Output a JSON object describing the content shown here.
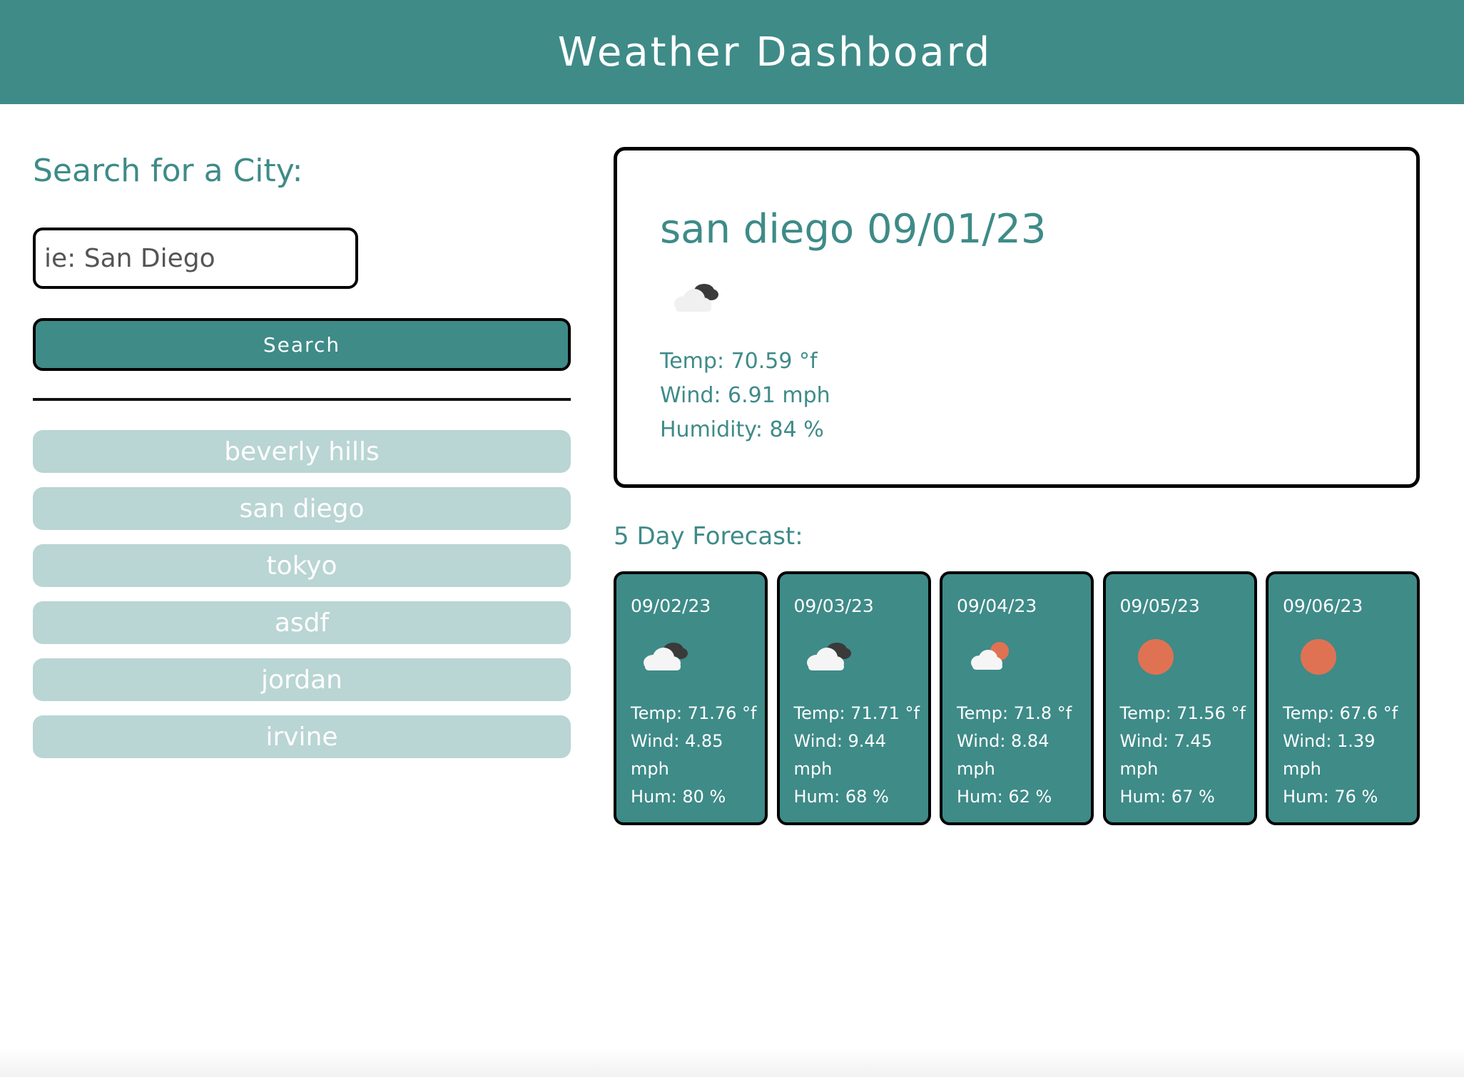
{
  "header": {
    "title": "Weather Dashboard"
  },
  "search": {
    "heading": "Search for a City:",
    "placeholder": "ie: San Diego",
    "value": "",
    "button_label": "Search"
  },
  "history": [
    {
      "label": "beverly hills"
    },
    {
      "label": "san diego"
    },
    {
      "label": "tokyo"
    },
    {
      "label": "asdf"
    },
    {
      "label": "jordan"
    },
    {
      "label": "irvine"
    }
  ],
  "current": {
    "title": "san diego 09/01/23",
    "icon": "broken-clouds-icon",
    "temp": "Temp: 70.59 °f",
    "wind": "Wind: 6.91 mph",
    "humidity": "Humidity: 84 %"
  },
  "forecast": {
    "heading": "5 Day Forecast:",
    "days": [
      {
        "date": "09/02/23",
        "icon": "broken-clouds-icon",
        "temp": "Temp: 71.76 °f",
        "wind": "Wind: 4.85 mph",
        "hum": "Hum: 80 %"
      },
      {
        "date": "09/03/23",
        "icon": "broken-clouds-icon",
        "temp": "Temp: 71.71 °f",
        "wind": "Wind: 9.44 mph",
        "hum": "Hum: 68 %"
      },
      {
        "date": "09/04/23",
        "icon": "partly-cloudy-icon",
        "temp": "Temp: 71.8 °f",
        "wind": "Wind: 8.84 mph",
        "hum": "Hum: 62 %"
      },
      {
        "date": "09/05/23",
        "icon": "clear-sky-icon",
        "temp": "Temp: 71.56 °f",
        "wind": "Wind: 7.45 mph",
        "hum": "Hum: 67 %"
      },
      {
        "date": "09/06/23",
        "icon": "clear-sky-icon",
        "temp": "Temp: 67.6 °f",
        "wind": "Wind: 1.39 mph",
        "hum": "Hum: 76 %"
      }
    ]
  },
  "colors": {
    "primary": "#3e8b88",
    "history_button": "#b9d5d4",
    "sun": "#e07254",
    "cloud": "#f2f2f2",
    "dark_cloud": "#444444"
  }
}
